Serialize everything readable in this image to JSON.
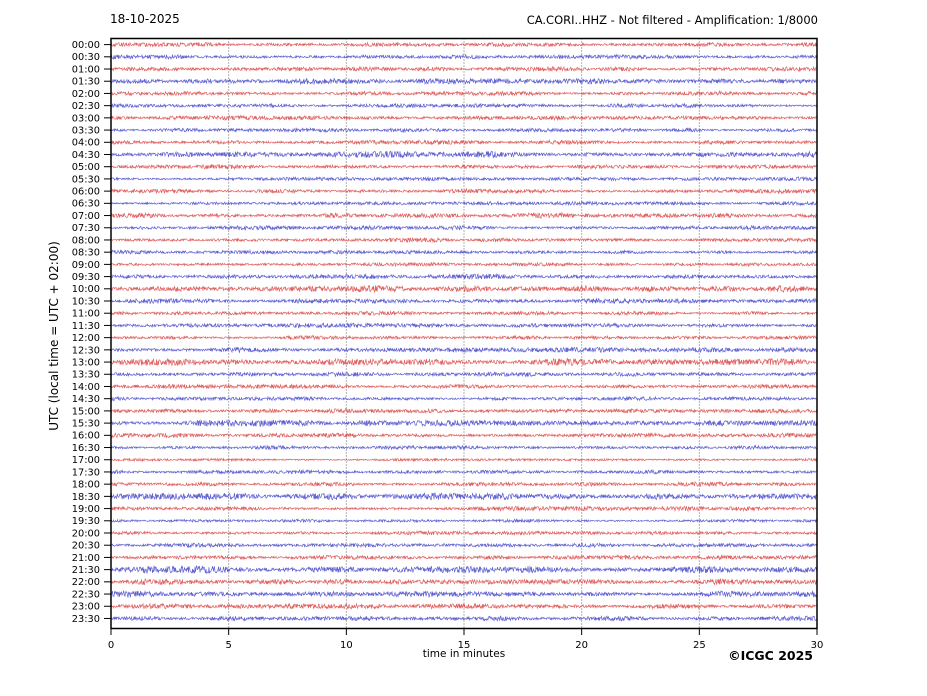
{
  "header": {
    "date": "18-10-2025",
    "title": "CA.CORI..HHZ - Not filtered - Amplification: 1/8000"
  },
  "axes": {
    "ylabel": "UTC (local time = UTC + 02:00)",
    "xlabel": "time in minutes",
    "x_ticks": [
      0,
      5,
      10,
      15,
      20,
      25,
      30
    ]
  },
  "footer": {
    "copyright": "©ICGC 2025"
  },
  "colors": {
    "trace_hour": "#d83c3c",
    "trace_half": "#3c3cc8",
    "grid": "#666666",
    "frame": "#000000",
    "text": "#000000"
  },
  "chart_data": {
    "type": "line",
    "subtype": "helicorder-seismogram",
    "title": "CA.CORI..HHZ - Not filtered - Amplification: 1/8000",
    "xlabel": "time in minutes",
    "ylabel": "UTC (local time = UTC + 02:00)",
    "x_range_minutes": [
      0,
      30
    ],
    "grid_interval_minutes": 5,
    "minutes_per_row": 30,
    "row_color_rule": "red on the hour, blue on the half hour",
    "rows": [
      {
        "time": "00:00",
        "color": "hour",
        "amplitude": 1.0
      },
      {
        "time": "00:30",
        "color": "half",
        "amplitude": 1.0
      },
      {
        "time": "01:00",
        "color": "hour",
        "amplitude": 1.1
      },
      {
        "time": "01:30",
        "color": "half",
        "amplitude": 1.5
      },
      {
        "time": "02:00",
        "color": "hour",
        "amplitude": 1.1
      },
      {
        "time": "02:30",
        "color": "half",
        "amplitude": 0.9
      },
      {
        "time": "03:00",
        "color": "hour",
        "amplitude": 1.0
      },
      {
        "time": "03:30",
        "color": "half",
        "amplitude": 0.9
      },
      {
        "time": "04:00",
        "color": "hour",
        "amplitude": 1.0
      },
      {
        "time": "04:30",
        "color": "half",
        "amplitude": 1.5
      },
      {
        "time": "05:00",
        "color": "hour",
        "amplitude": 1.0
      },
      {
        "time": "05:30",
        "color": "half",
        "amplitude": 0.9
      },
      {
        "time": "06:00",
        "color": "hour",
        "amplitude": 1.0
      },
      {
        "time": "06:30",
        "color": "half",
        "amplitude": 0.9
      },
      {
        "time": "07:00",
        "color": "hour",
        "amplitude": 1.2
      },
      {
        "time": "07:30",
        "color": "half",
        "amplitude": 1.0
      },
      {
        "time": "08:00",
        "color": "hour",
        "amplitude": 1.0
      },
      {
        "time": "08:30",
        "color": "half",
        "amplitude": 0.9
      },
      {
        "time": "09:00",
        "color": "hour",
        "amplitude": 0.9
      },
      {
        "time": "09:30",
        "color": "half",
        "amplitude": 1.2
      },
      {
        "time": "10:00",
        "color": "hour",
        "amplitude": 1.6
      },
      {
        "time": "10:30",
        "color": "half",
        "amplitude": 1.1
      },
      {
        "time": "11:00",
        "color": "hour",
        "amplitude": 0.9
      },
      {
        "time": "11:30",
        "color": "half",
        "amplitude": 1.0
      },
      {
        "time": "12:00",
        "color": "hour",
        "amplitude": 0.9
      },
      {
        "time": "12:30",
        "color": "half",
        "amplitude": 1.2
      },
      {
        "time": "13:00",
        "color": "hour",
        "amplitude": 1.7
      },
      {
        "time": "13:30",
        "color": "half",
        "amplitude": 1.0
      },
      {
        "time": "14:00",
        "color": "hour",
        "amplitude": 1.0
      },
      {
        "time": "14:30",
        "color": "half",
        "amplitude": 0.9
      },
      {
        "time": "15:00",
        "color": "hour",
        "amplitude": 1.0
      },
      {
        "time": "15:30",
        "color": "half",
        "amplitude": 1.5
      },
      {
        "time": "16:00",
        "color": "hour",
        "amplitude": 1.1
      },
      {
        "time": "16:30",
        "color": "half",
        "amplitude": 0.9
      },
      {
        "time": "17:00",
        "color": "hour",
        "amplitude": 0.7
      },
      {
        "time": "17:30",
        "color": "half",
        "amplitude": 0.9
      },
      {
        "time": "18:00",
        "color": "hour",
        "amplitude": 1.0
      },
      {
        "time": "18:30",
        "color": "half",
        "amplitude": 1.6
      },
      {
        "time": "19:00",
        "color": "hour",
        "amplitude": 1.1
      },
      {
        "time": "19:30",
        "color": "half",
        "amplitude": 0.8
      },
      {
        "time": "20:00",
        "color": "hour",
        "amplitude": 0.9
      },
      {
        "time": "20:30",
        "color": "half",
        "amplitude": 1.0
      },
      {
        "time": "21:00",
        "color": "hour",
        "amplitude": 1.0
      },
      {
        "time": "21:30",
        "color": "half",
        "amplitude": 1.7
      },
      {
        "time": "22:00",
        "color": "hour",
        "amplitude": 1.3
      },
      {
        "time": "22:30",
        "color": "half",
        "amplitude": 1.4
      },
      {
        "time": "23:00",
        "color": "hour",
        "amplitude": 1.2
      },
      {
        "time": "23:30",
        "color": "half",
        "amplitude": 1.1
      }
    ]
  }
}
